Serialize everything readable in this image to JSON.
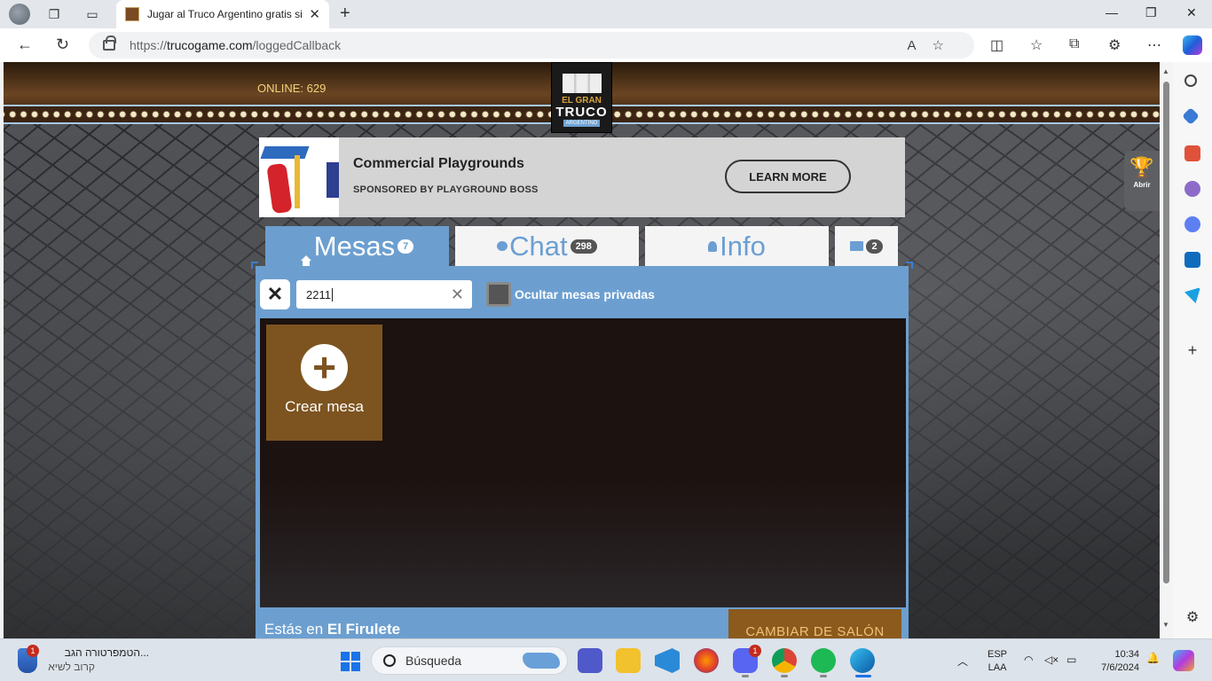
{
  "browser": {
    "tab_title": "Jugar al Truco Argentino gratis si",
    "url_proto": "https://",
    "url_host": "trucogame.com",
    "url_path": "/loggedCallback"
  },
  "site": {
    "online_label": "ONLINE: 629",
    "logo": {
      "line1": "EL GRAN",
      "line2": "TRUCO",
      "line3": "ARGENTINO"
    },
    "trophy_label": "Abrir"
  },
  "ad": {
    "headline": "Commercial Playgrounds",
    "sponsor": "SPONSORED BY PLAYGROUND BOSS",
    "cta": "LEARN MORE"
  },
  "tabs": [
    {
      "label": "Mesas",
      "count": "7",
      "icon": "home-icon"
    },
    {
      "label": "Chat",
      "count": "298",
      "icon": "chat-bubble-icon"
    },
    {
      "label": "Info",
      "count": "",
      "icon": "user-icon"
    },
    {
      "label": "",
      "count": "2",
      "icon": "mail-icon"
    }
  ],
  "filter": {
    "search_value": "2211",
    "hide_private_label": "Ocultar mesas privadas",
    "hide_private_checked": false
  },
  "create_table_label": "Crear mesa",
  "footer": {
    "where_prefix": "Estás en",
    "salon": "El Firulete",
    "change_button": "CAMBIAR DE SALÓN"
  },
  "taskbar": {
    "weather_line1": "...הטמפרטורה הגב",
    "weather_line2": "קרוב לשיא",
    "weather_badge": "1",
    "search_placeholder": "Búsqueda",
    "discord_badge": "1",
    "lang_line1": "ESP",
    "lang_line2": "LAA",
    "time": "10:34",
    "date": "7/6/2024"
  },
  "colors": {
    "accent_blue": "#6c9fd0",
    "wood": "#7d5420",
    "gold": "#f6d27a"
  }
}
